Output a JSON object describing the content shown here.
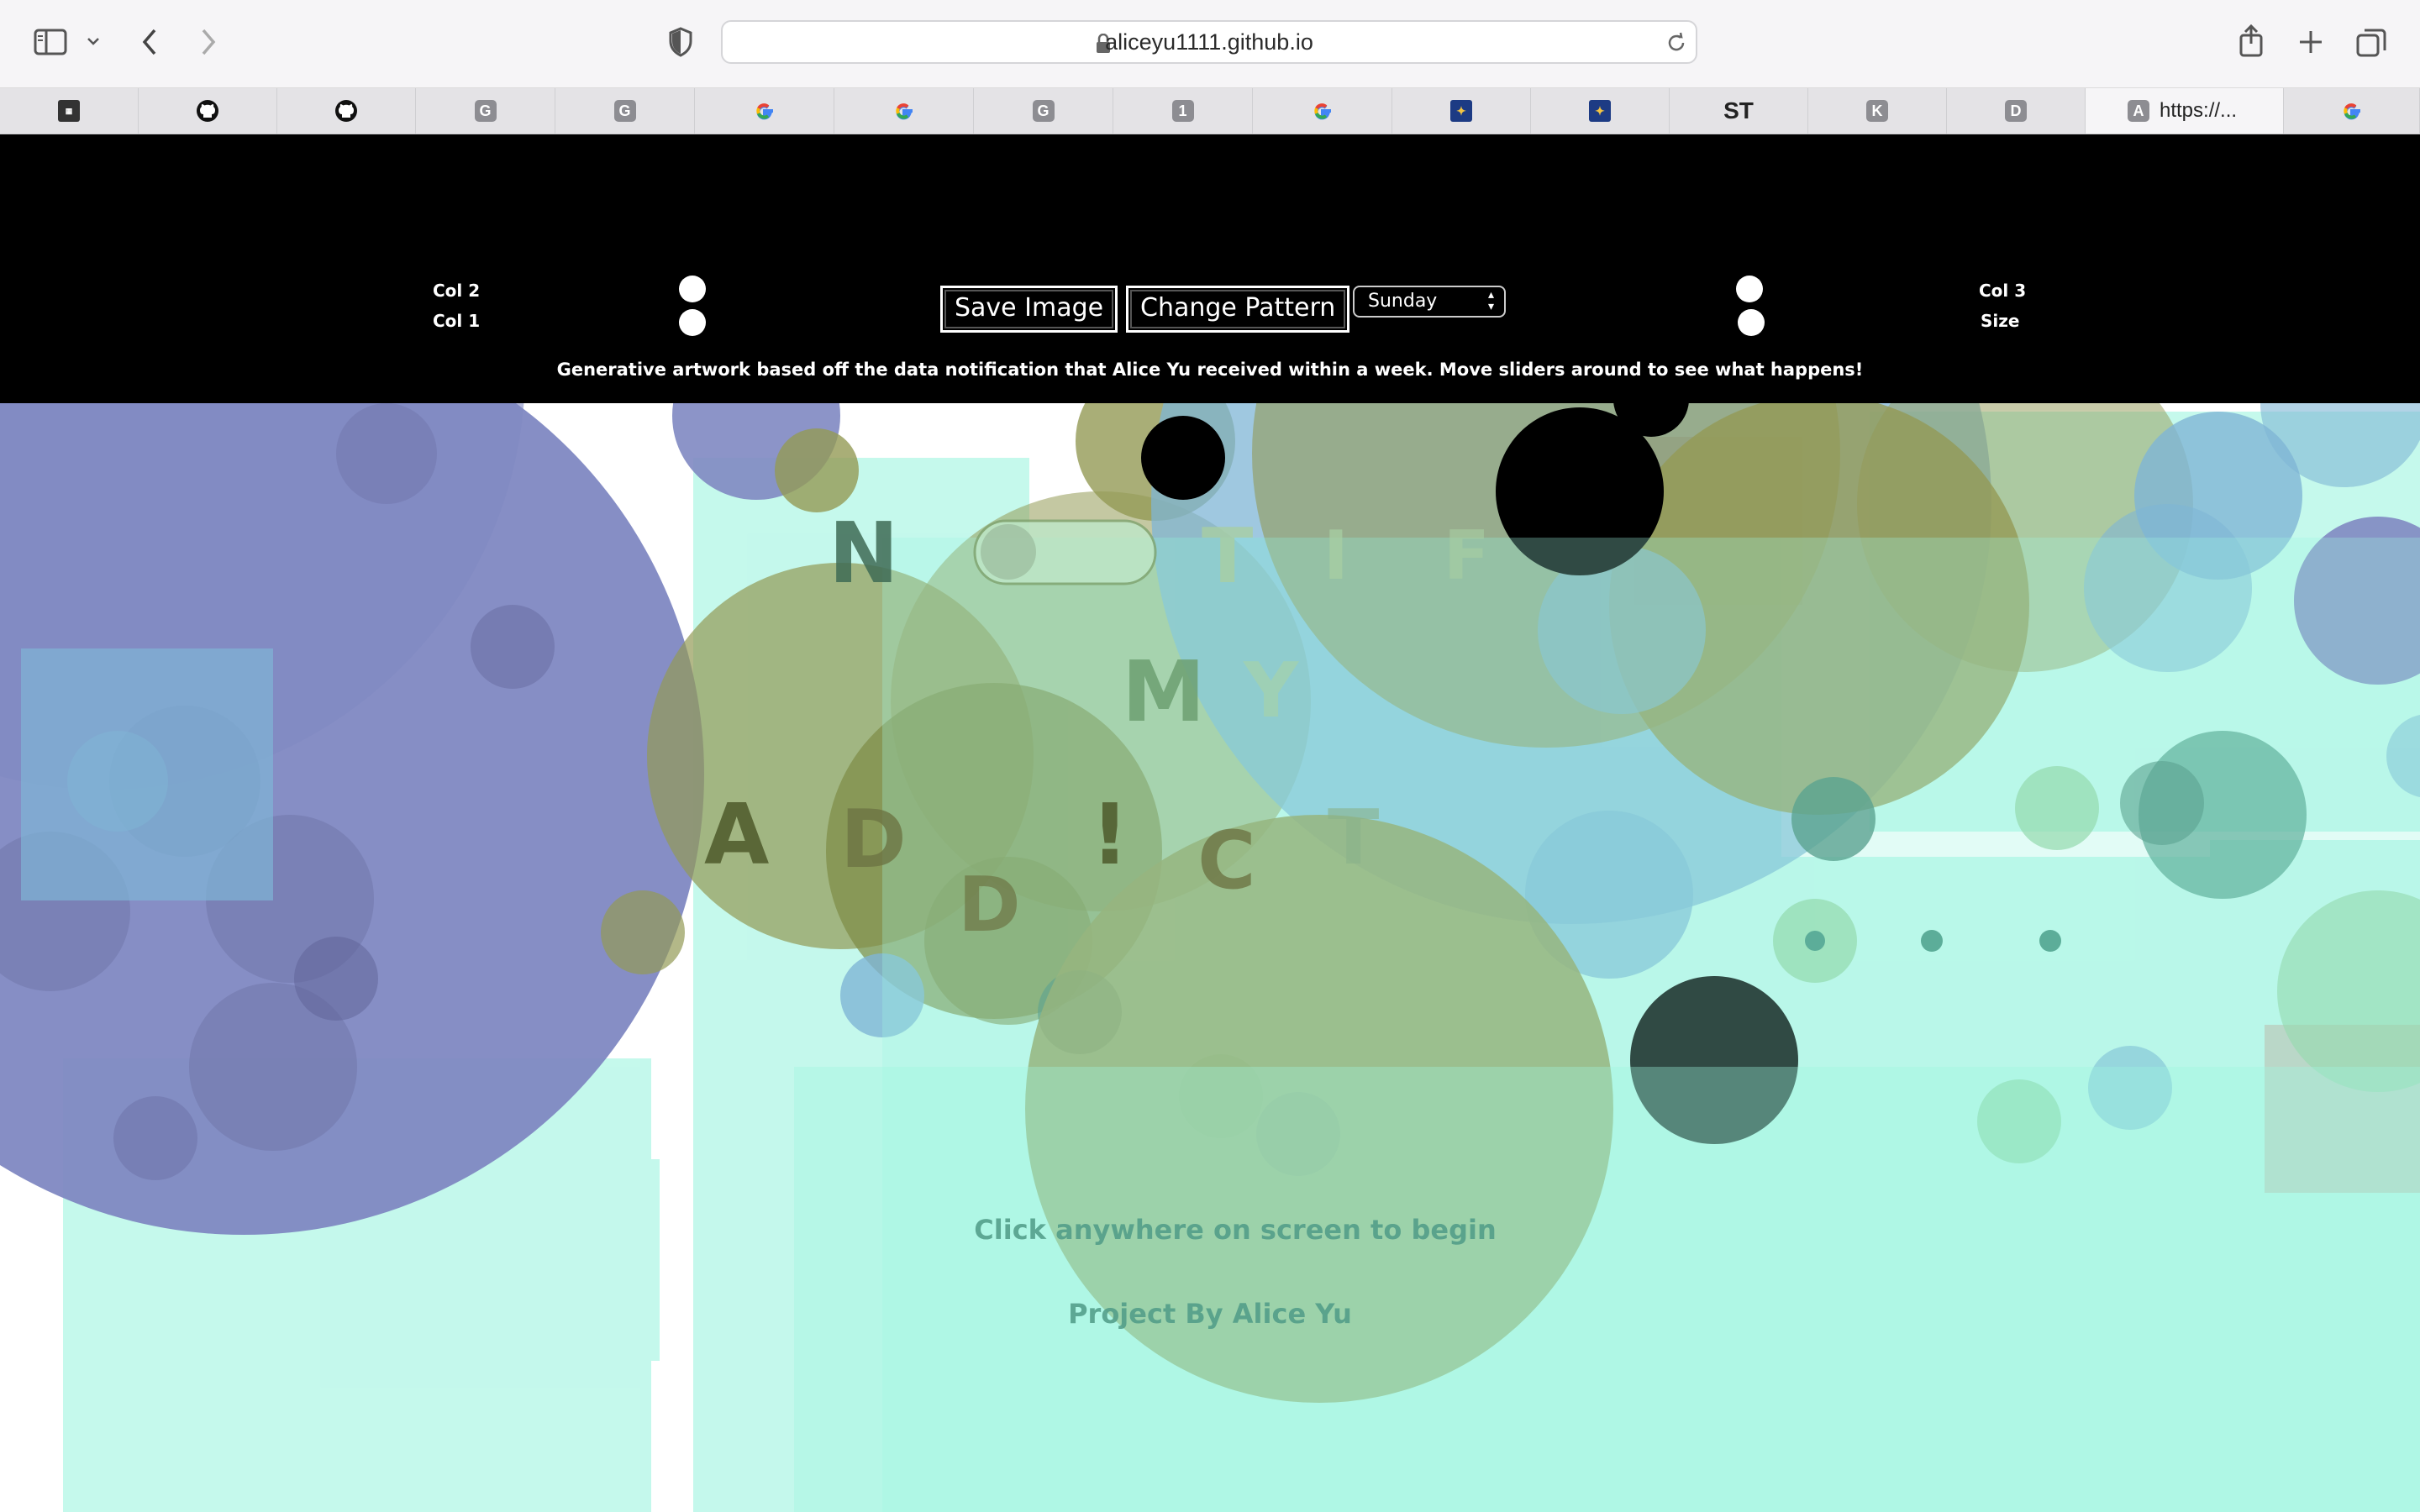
{
  "browser": {
    "url": "aliceyu1111.github.io",
    "tabs": [
      {
        "favicon": "mini",
        "label": ""
      },
      {
        "favicon": "github-icon",
        "label": ""
      },
      {
        "favicon": "github-icon",
        "label": ""
      },
      {
        "favicon": "G",
        "label": ""
      },
      {
        "favicon": "G",
        "label": ""
      },
      {
        "favicon": "google-icon",
        "label": ""
      },
      {
        "favicon": "google-icon",
        "label": ""
      },
      {
        "favicon": "G",
        "label": ""
      },
      {
        "favicon": "1",
        "label": ""
      },
      {
        "favicon": "google-icon",
        "label": ""
      },
      {
        "favicon": "ucb-icon",
        "label": ""
      },
      {
        "favicon": "ucb-icon",
        "label": ""
      },
      {
        "favicon": "ST",
        "label": ""
      },
      {
        "favicon": "K",
        "label": ""
      },
      {
        "favicon": "D",
        "label": ""
      },
      {
        "favicon": "A",
        "label": "https://..."
      },
      {
        "favicon": "google-icon",
        "label": ""
      }
    ]
  },
  "controls": {
    "col2_label": "Col 2",
    "col1_label": "Col 1",
    "col3_label": "Col 3",
    "size_label": "Size",
    "save_button": "Save Image",
    "change_button": "Change Pattern",
    "day_select": "Sunday",
    "description": "Generative artwork based off the data notification that Alice Yu received within a week. Move sliders around to see what happens!"
  },
  "artwork": {
    "letters": [
      "N",
      "T",
      "I",
      "F",
      "M",
      "Y",
      "A",
      "D",
      "!",
      "C",
      "T",
      "D"
    ],
    "click_prompt": "Click anywhere on screen to begin",
    "credit": "Project By Alice Yu"
  },
  "colors": {
    "purple": "#8088c2",
    "olive": "#939a55",
    "mint": "#9ef5e0",
    "blue": "#7fb5d6",
    "teal": "#3f7f6e",
    "black": "#000000"
  }
}
